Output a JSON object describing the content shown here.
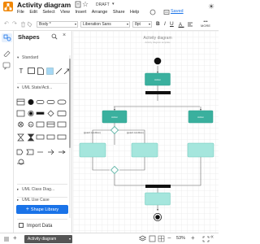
{
  "app": {
    "title": "Activity diagram",
    "status_badge": "DRAFT",
    "saved_label": "Saved",
    "menu": [
      "File",
      "Edit",
      "Select",
      "View",
      "Insert",
      "Arrange",
      "Share",
      "Help"
    ],
    "brand_color": "#f08705"
  },
  "toolbar": {
    "style_select": "Body *",
    "font_select": "Liberation Sans",
    "font_size": "8pt",
    "more_label": "MORE",
    "accent": "#1a73e8"
  },
  "sidebar": {
    "title": "Shapes",
    "sections": [
      {
        "label": "Standard"
      },
      {
        "label": "UML State/Acti..."
      },
      {
        "label": "UML Class Diag..."
      },
      {
        "label": "UML Use Case"
      }
    ],
    "shape_library_button": "Shape Library",
    "import_data": "Import Data"
  },
  "canvas": {
    "diagram_title": "Activity diagram",
    "diagram_subtitle": "Activity diagram template",
    "guard_true": "[guard condition]",
    "guard_false": "[guard condition]",
    "node_action": "Action",
    "node_colors": {
      "dark": "#3ab09e",
      "light": "#a5e6dd",
      "stroke": "#2e9e8c"
    }
  },
  "statusbar": {
    "page_tab": "Activity diagram",
    "zoom": "53%"
  }
}
